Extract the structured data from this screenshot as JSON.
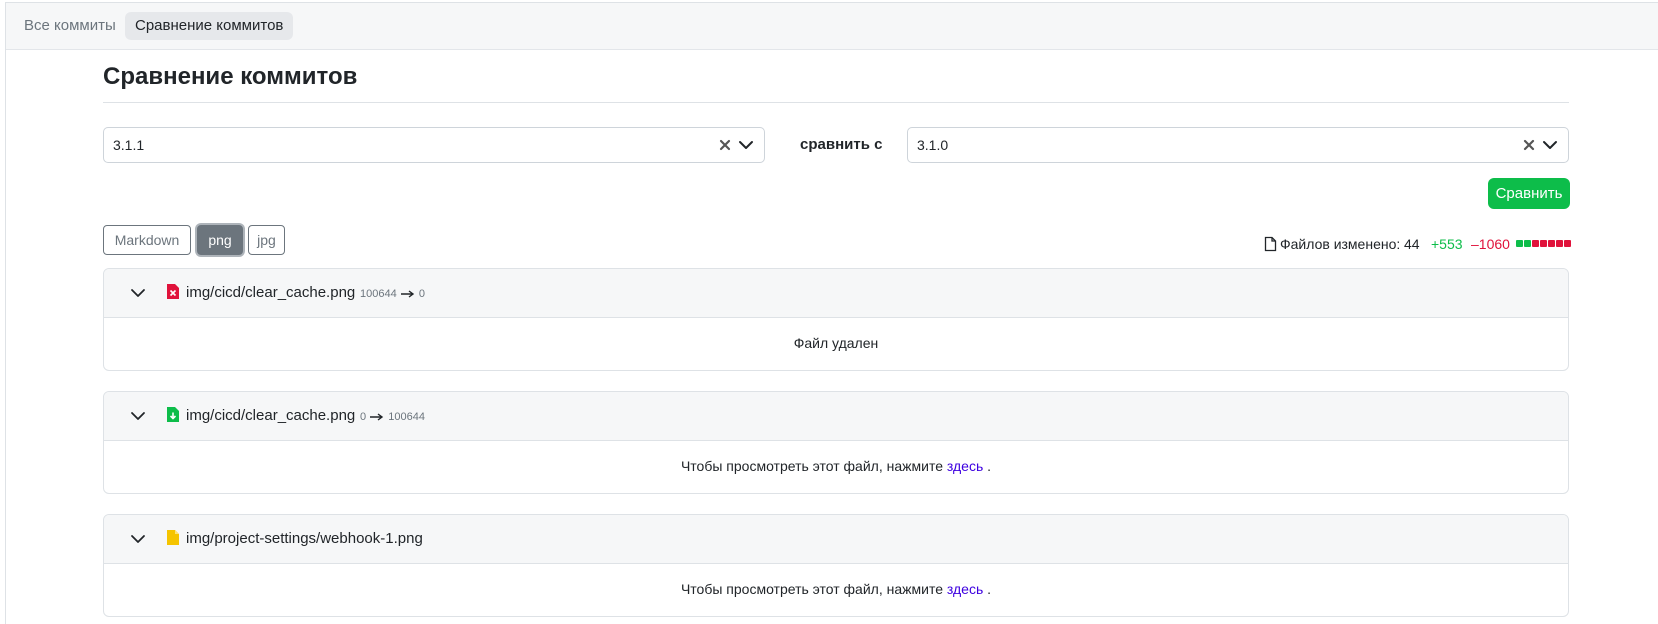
{
  "tabs": [
    {
      "label": "Все коммиты",
      "active": false
    },
    {
      "label": "Сравнение коммитов",
      "active": true
    }
  ],
  "page": {
    "title": "Сравнение коммитов"
  },
  "compare": {
    "from_value": "3.1.1",
    "to_value": "3.1.0",
    "with_label": "сравнить с",
    "button_label": "Сравнить"
  },
  "filters": [
    {
      "label": "Markdown",
      "active": false
    },
    {
      "label": "png",
      "active": true
    },
    {
      "label": "jpg",
      "active": false
    }
  ],
  "stats": {
    "files_label": "Файлов изменено:",
    "files_count": "44",
    "additions": "+553",
    "deletions": "–1060",
    "bar": [
      "#0dbd4a",
      "#0dbd4a",
      "#e0123b",
      "#e0123b",
      "#e0123b",
      "#e0123b",
      "#e0123b"
    ]
  },
  "files": [
    {
      "path": "img/cicd/clear_cache.png",
      "icon": "file-deleted-icon",
      "icon_color": "#e0123b",
      "mode_from": "100644",
      "mode_to": "0",
      "message": "Файл удален",
      "link_text": ""
    },
    {
      "path": "img/cicd/clear_cache.png",
      "icon": "file-added-icon",
      "icon_color": "#0dbd4a",
      "mode_from": "0",
      "mode_to": "100644",
      "message": "Чтобы просмотреть этот файл, нажмите",
      "link_text": "здесь",
      "message_end": "."
    },
    {
      "path": "img/project-settings/webhook-1.png",
      "icon": "file-modified-icon",
      "icon_color": "#f5c400",
      "mode_from": "",
      "mode_to": "",
      "message": "Чтобы просмотреть этот файл, нажмите",
      "link_text": "здесь",
      "message_end": "."
    }
  ]
}
